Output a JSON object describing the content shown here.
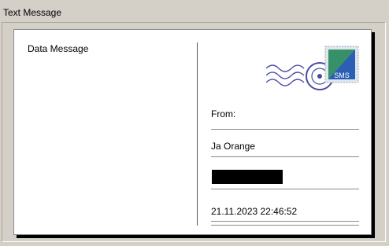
{
  "window": {
    "title": "Text Message"
  },
  "card": {
    "body_label": "Data Message",
    "from_label": "From:",
    "sender": "Ja Orange",
    "timestamp": "21.11.2023 22:46:52",
    "stamp_text": "SMS"
  },
  "colors": {
    "background": "#d4d0c8",
    "postmark": "#4a4aa6",
    "stamp_blue": "#2c5eb4",
    "stamp_green": "#3a9a5a"
  },
  "icons": [
    "postmark-icon",
    "sms-stamp-icon"
  ]
}
